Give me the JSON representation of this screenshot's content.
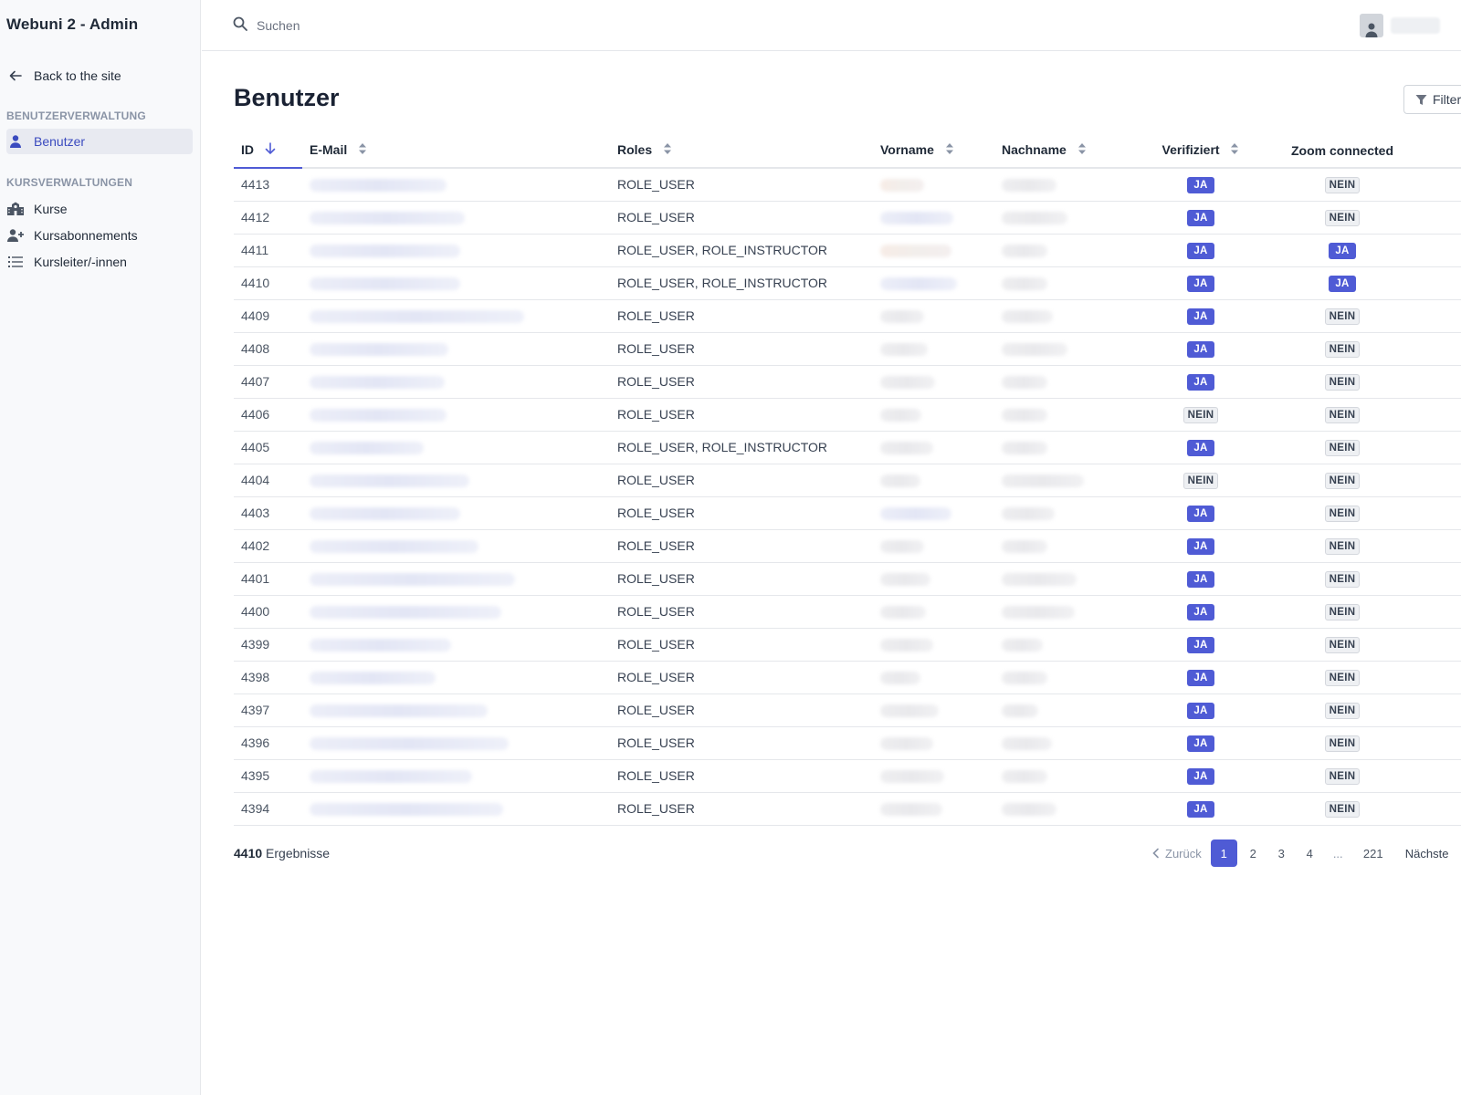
{
  "app": {
    "title": "Webuni 2 - Admin"
  },
  "sidebar": {
    "back_label": "Back to the site",
    "sections": [
      {
        "title": "BENUTZERVERWALTUNG",
        "items": [
          {
            "label": "Benutzer",
            "icon": "user-icon",
            "active": true
          }
        ]
      },
      {
        "title": "KURSVERWALTUNGEN",
        "items": [
          {
            "label": "Kurse",
            "icon": "school-icon"
          },
          {
            "label": "Kursabonnements",
            "icon": "user-plus-icon"
          },
          {
            "label": "Kursleiter/-innen",
            "icon": "list-icon"
          }
        ]
      }
    ]
  },
  "search": {
    "placeholder": "Suchen"
  },
  "page": {
    "title": "Benutzer",
    "filter_label": "Filter"
  },
  "table": {
    "columns": [
      "ID",
      "E-Mail",
      "Roles",
      "Vorname",
      "Nachname",
      "Verifiziert",
      "Zoom connected"
    ],
    "rows": [
      {
        "id": "4413",
        "roles": "ROLE_USER",
        "verified": "JA",
        "zoom": "NEIN"
      },
      {
        "id": "4412",
        "roles": "ROLE_USER",
        "verified": "JA",
        "zoom": "NEIN"
      },
      {
        "id": "4411",
        "roles": "ROLE_USER, ROLE_INSTRUCTOR",
        "verified": "JA",
        "zoom": "JA"
      },
      {
        "id": "4410",
        "roles": "ROLE_USER, ROLE_INSTRUCTOR",
        "verified": "JA",
        "zoom": "JA"
      },
      {
        "id": "4409",
        "roles": "ROLE_USER",
        "verified": "JA",
        "zoom": "NEIN"
      },
      {
        "id": "4408",
        "roles": "ROLE_USER",
        "verified": "JA",
        "zoom": "NEIN"
      },
      {
        "id": "4407",
        "roles": "ROLE_USER",
        "verified": "JA",
        "zoom": "NEIN"
      },
      {
        "id": "4406",
        "roles": "ROLE_USER",
        "verified": "NEIN",
        "zoom": "NEIN"
      },
      {
        "id": "4405",
        "roles": "ROLE_USER, ROLE_INSTRUCTOR",
        "verified": "JA",
        "zoom": "NEIN"
      },
      {
        "id": "4404",
        "roles": "ROLE_USER",
        "verified": "NEIN",
        "zoom": "NEIN"
      },
      {
        "id": "4403",
        "roles": "ROLE_USER",
        "verified": "JA",
        "zoom": "NEIN"
      },
      {
        "id": "4402",
        "roles": "ROLE_USER",
        "verified": "JA",
        "zoom": "NEIN"
      },
      {
        "id": "4401",
        "roles": "ROLE_USER",
        "verified": "JA",
        "zoom": "NEIN"
      },
      {
        "id": "4400",
        "roles": "ROLE_USER",
        "verified": "JA",
        "zoom": "NEIN"
      },
      {
        "id": "4399",
        "roles": "ROLE_USER",
        "verified": "JA",
        "zoom": "NEIN"
      },
      {
        "id": "4398",
        "roles": "ROLE_USER",
        "verified": "JA",
        "zoom": "NEIN"
      },
      {
        "id": "4397",
        "roles": "ROLE_USER",
        "verified": "JA",
        "zoom": "NEIN"
      },
      {
        "id": "4396",
        "roles": "ROLE_USER",
        "verified": "JA",
        "zoom": "NEIN"
      },
      {
        "id": "4395",
        "roles": "ROLE_USER",
        "verified": "JA",
        "zoom": "NEIN"
      },
      {
        "id": "4394",
        "roles": "ROLE_USER",
        "verified": "JA",
        "zoom": "NEIN"
      }
    ],
    "row_action_glyph": "•"
  },
  "footer": {
    "results_count": "4410",
    "results_label": "Ergebnisse",
    "pagination": {
      "prev": "Zurück",
      "pages": [
        "1",
        "2",
        "3",
        "4",
        "...",
        "221"
      ],
      "current": "1",
      "next": "Nächste"
    }
  },
  "colors": {
    "accent": "#4f5bd5",
    "sidebar_bg": "#f8f9fb",
    "active_item_bg": "#e8eaf1"
  }
}
